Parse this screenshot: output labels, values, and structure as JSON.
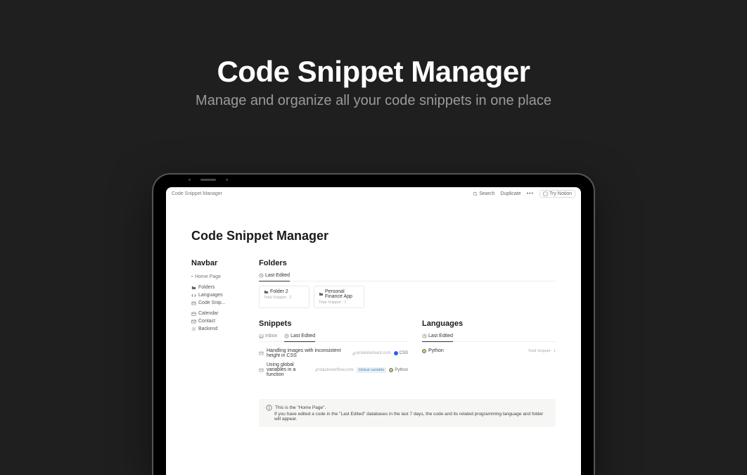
{
  "hero": {
    "title": "Code Snippet Manager",
    "subtitle": "Manage and organize all your code snippets in one place"
  },
  "topbar": {
    "breadcrumb": "Code Snippet Manager",
    "search": "Search",
    "duplicate": "Duplicate",
    "try": "Try Notion"
  },
  "page": {
    "title": "Code Snippet Manager"
  },
  "navbar": {
    "title": "Navbar",
    "home": "Home Page",
    "folders": "Folders",
    "languages": "Languages",
    "code_snip": "Code Snip...",
    "calendar": "Calendar",
    "contact": "Contact",
    "backend": "Backend"
  },
  "folders": {
    "title": "Folders",
    "tab_last_edited": "Last Edited",
    "cards": [
      {
        "name": "Folder 2",
        "meta": "Total Snippet : 2"
      },
      {
        "name": "Personal Finance App",
        "meta": "Total Snippet : 1"
      }
    ]
  },
  "snippets": {
    "title": "Snippets",
    "tab_inbox": "Inbox",
    "tab_last_edited": "Last Edited",
    "items": [
      {
        "title": "Handling images with inconsistent height in CSS",
        "src": "arslanreckant.com",
        "tag": "",
        "lang": "CSS",
        "lang_class": "css"
      },
      {
        "title": "Using global variables in a function",
        "src": "stackoverflow.com",
        "tag": "Global variable",
        "lang": "Python",
        "lang_class": "python"
      }
    ]
  },
  "languages": {
    "title": "Languages",
    "tab_last_edited": "Last Edited",
    "items": [
      {
        "name": "Python",
        "meta": "Total Snippet : 1",
        "lang_class": "python"
      }
    ]
  },
  "info": {
    "line1": "This is the \"Home Page\".",
    "line2": "If you have edited a code in the \"Last Edited\" databases in the last 7 days, the code and its related programming language and folder will appear."
  }
}
